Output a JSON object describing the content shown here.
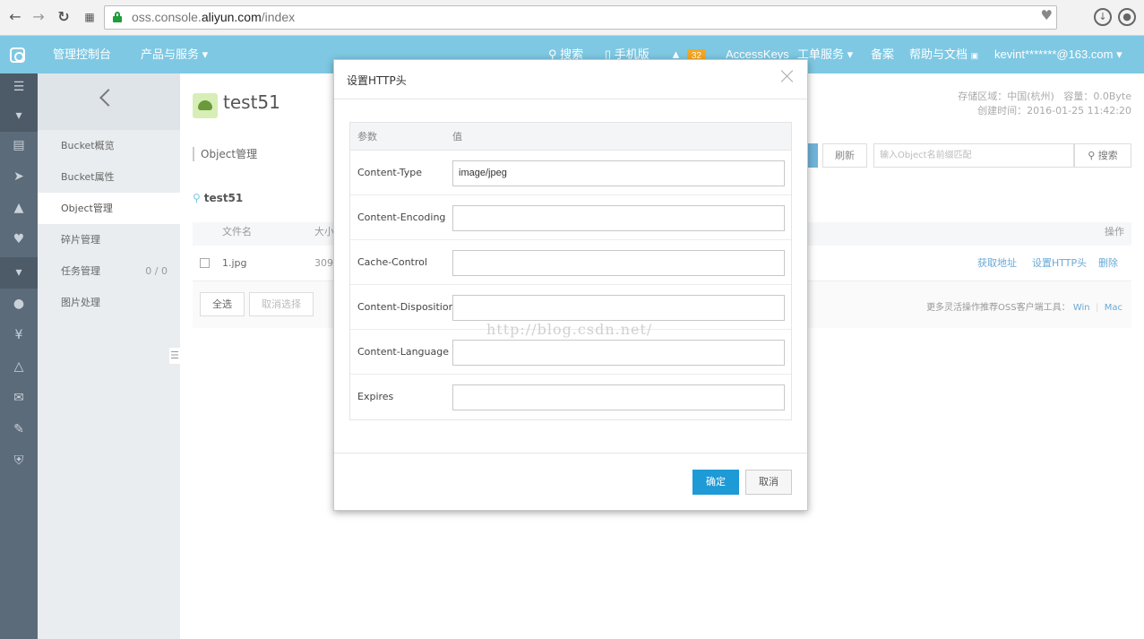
{
  "browser": {
    "url_prefix": "oss.console.",
    "url_domain": "aliyun.com",
    "url_path": "/index",
    "back_icon": "arrow-left-icon",
    "forward_icon": "arrow-right-icon",
    "reload_icon": "reload-icon",
    "apps_icon": "apps-grid-icon",
    "heart_icon": "heart-icon",
    "download_icon": "download-icon",
    "account_icon": "account-icon"
  },
  "topnav": {
    "console": "管理控制台",
    "products": "产品与服务",
    "search": "搜索",
    "mobile": "手机版",
    "notifications_count": "32",
    "accesskeys": "AccessKeys",
    "tickets": "工单服务",
    "filing": "备案",
    "help": "帮助与文档",
    "user": "kevint*******@163.com",
    "accent_color": "#7ec8e3"
  },
  "sidebar": {
    "items": [
      {
        "label": "Bucket概览"
      },
      {
        "label": "Bucket属性"
      },
      {
        "label": "Object管理"
      },
      {
        "label": "碎片管理"
      },
      {
        "label": "任务管理",
        "count": "0 / 0"
      },
      {
        "label": "图片处理"
      }
    ]
  },
  "main": {
    "bucket_name": "test51",
    "region": "存储区域：中国(杭州)",
    "capacity": "容量：0.0Byte",
    "created": "创建时间：2016-01-25 11:42:20",
    "section_title": "Object管理",
    "refresh": "刷新",
    "search_placeholder": "输入Object名前缀匹配",
    "search_button": "搜索",
    "path": "test51",
    "columns": {
      "filename": "文件名",
      "size": "大小",
      "actions": "操作"
    },
    "row": {
      "filename": "1.jpg",
      "size": "309",
      "get_url": "获取地址",
      "set_http": "设置HTTP头",
      "delete": "删除"
    },
    "select_all": "全选",
    "unselect": "取消选择",
    "footnote": "更多灵活操作推荐OSS客户端工具：",
    "win": "Win",
    "mac": "Mac",
    "watermark": "http://blog.csdn.net/"
  },
  "modal": {
    "title": "设置HTTP头",
    "col_param": "参数",
    "col_value": "值",
    "fields": [
      {
        "label": "Content-Type",
        "value": "image/jpeg"
      },
      {
        "label": "Content-Encoding",
        "value": ""
      },
      {
        "label": "Cache-Control",
        "value": ""
      },
      {
        "label": "Content-Disposition",
        "value": ""
      },
      {
        "label": "Content-Language",
        "value": ""
      },
      {
        "label": "Expires",
        "value": ""
      }
    ],
    "ok": "确定",
    "cancel": "取消",
    "primary_color": "#1e9ad6"
  }
}
